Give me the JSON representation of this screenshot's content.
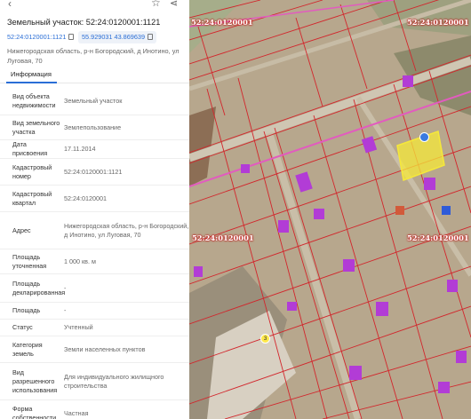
{
  "header": {
    "title": "Земельный участок: 52:24:0120001:1121",
    "cad_number": "52:24:0120001:1121",
    "coordinates": "55.929031 43.869639",
    "address": "Нижегородская область, р-н Богородский, д Инотино, ул Луговая, 70"
  },
  "tabs": [
    {
      "label": "Информация"
    }
  ],
  "rows": [
    {
      "key": "Вид объекта недвижимости",
      "value": "Земельный участок"
    },
    {
      "key": "Вид земельного участка",
      "value": "Землепользование"
    },
    {
      "key": "Дата присвоения",
      "value": "17.11.2014"
    },
    {
      "key": "Кадастровый номер",
      "value": "52:24:0120001:1121"
    },
    {
      "key": "Кадастровый квартал",
      "value": "52:24:0120001"
    },
    {
      "key": "Адрес",
      "value": "Нижегородская область, р-н Богородский, д Инотино, ул Луговая, 70"
    },
    {
      "key": "Площадь уточненная",
      "value": "1 000 кв. м"
    },
    {
      "key": "Площадь декларированная",
      "value": "-"
    },
    {
      "key": "Площадь",
      "value": "-"
    },
    {
      "key": "Статус",
      "value": "Учтенный"
    },
    {
      "key": "Категория земель",
      "value": "Земли населенных пунктов"
    },
    {
      "key": "Вид разрешенного использования",
      "value": "Для индивидуального жилищного строительства"
    },
    {
      "key": "Форма собственности",
      "value": "Частная"
    }
  ],
  "map": {
    "labels": [
      "52:24:0120001",
      "52:24:0120001",
      "52:24:0120001",
      "52:24:0120001"
    ],
    "pin_blue": "",
    "pin_yellow": "3"
  },
  "colors": {
    "accent": "#2a6ed6",
    "boundary": "#d2262c",
    "highlight": "#f5e83a",
    "roof": "#b23cd6"
  },
  "icons": [
    "back-arrow-icon",
    "star-icon",
    "share-icon",
    "copy-icon"
  ]
}
